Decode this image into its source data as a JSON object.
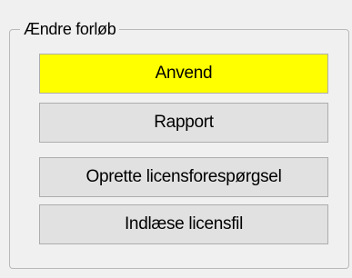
{
  "group": {
    "title": "Ændre forløb"
  },
  "buttons": [
    {
      "label": "Anvend",
      "highlight_color": "#ffff00"
    },
    {
      "label": "Rapport"
    },
    {
      "label": "Oprette licensforespørgsel"
    },
    {
      "label": "Indlæse licensfil"
    }
  ]
}
